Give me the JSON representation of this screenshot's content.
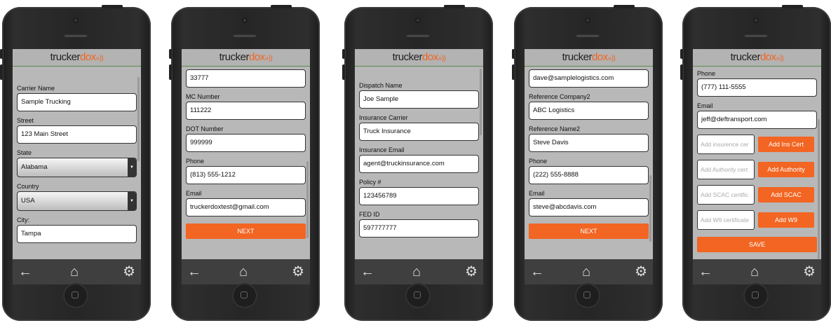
{
  "brand": {
    "part1": "trucker",
    "part2": "dox",
    "signal": "»))"
  },
  "toolbar": {
    "back_icon": "←",
    "home_icon": "⌂",
    "gear_icon": "⚙"
  },
  "screens": [
    {
      "fields": [
        {
          "label": "Carrier Name",
          "value": "Sample Trucking"
        },
        {
          "label": "Street",
          "value": "123 Main Street"
        },
        {
          "label": "State",
          "value": "Alabama",
          "type": "select"
        },
        {
          "label": "Country",
          "value": "USA",
          "type": "select"
        },
        {
          "label": "City:",
          "value": "Tampa"
        }
      ]
    },
    {
      "fields": [
        {
          "label": "",
          "value": "33777"
        },
        {
          "label": "MC Number",
          "value": "111222"
        },
        {
          "label": "DOT Number",
          "value": "999999"
        },
        {
          "label": "Phone",
          "value": "(813) 555-1212"
        },
        {
          "label": "Email",
          "value": "truckerdoxtest@gmail.com"
        }
      ],
      "next_label": "NEXT"
    },
    {
      "fields": [
        {
          "label": "Dispatch Name",
          "value": "Joe Sample"
        },
        {
          "label": "Insurance Carrier",
          "value": "Truck Insurance"
        },
        {
          "label": "Insurance Email",
          "value": "agent@truckinsurance.com"
        },
        {
          "label": "Policy #",
          "value": "123456789"
        },
        {
          "label": "FED ID",
          "value": "597777777"
        }
      ]
    },
    {
      "fields": [
        {
          "label": "",
          "value": "dave@samplelogistics.com"
        },
        {
          "label": "Reference Company2",
          "value": "ABC Logistics"
        },
        {
          "label": "Reference Name2",
          "value": "Steve Davis"
        },
        {
          "label": "Phone",
          "value": "(222) 555-8888"
        },
        {
          "label": "Email",
          "value": "steve@abcdavis.com"
        }
      ],
      "next_label": "NEXT"
    },
    {
      "fields": [
        {
          "label": "Phone",
          "value": "(777) 111-5555"
        },
        {
          "label": "Email",
          "value": "jeff@deftransport.com"
        }
      ],
      "uploads": [
        {
          "placeholder": "Add insurence cer",
          "button": "Add Ins Cert"
        },
        {
          "placeholder": "Add Authority cert",
          "button": "Add Authority"
        },
        {
          "placeholder": "Add SCAC certific",
          "button": "Add SCAC"
        },
        {
          "placeholder": "Add W9 certificate",
          "button": "Add W9"
        }
      ],
      "save_label": "SAVE"
    }
  ],
  "colors": {
    "accent": "#f26522",
    "screen_bg": "#b8b8b8",
    "toolbar_bg": "#3f3f3f"
  }
}
